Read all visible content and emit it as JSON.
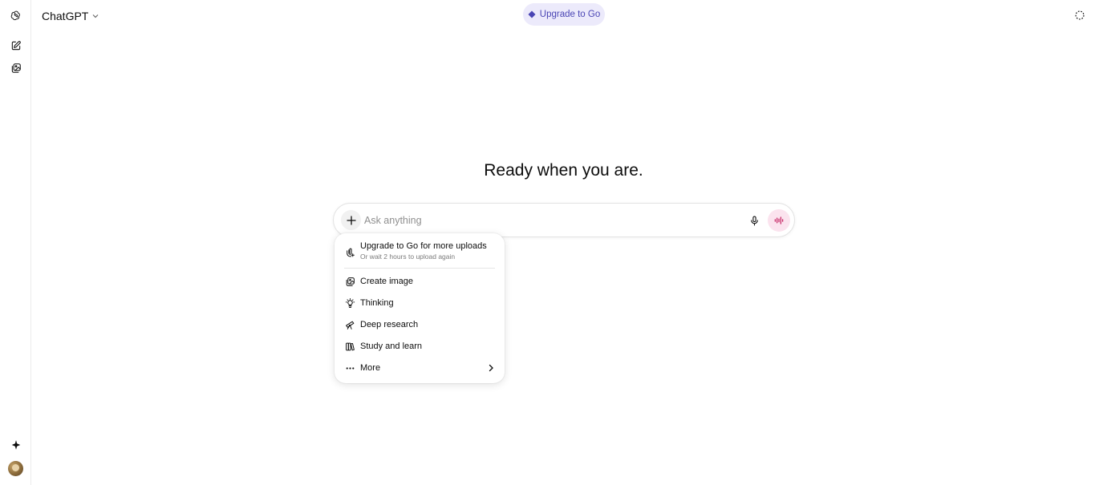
{
  "app": {
    "title": "ChatGPT"
  },
  "sidebar": {
    "items": [
      {
        "name": "logo",
        "icon": "openai-logo-icon"
      },
      {
        "name": "new-chat",
        "icon": "new-chat-icon"
      },
      {
        "name": "images",
        "icon": "images-icon"
      },
      {
        "name": "explore",
        "icon": "sparkle-icon"
      },
      {
        "name": "profile",
        "icon": "avatar"
      }
    ]
  },
  "header": {
    "model_label": "ChatGPT",
    "upgrade_label": "Upgrade to Go",
    "upgrade_color": "#4a45b4"
  },
  "main": {
    "headline": "Ready when you are."
  },
  "composer": {
    "placeholder": "Ask anything",
    "value": ""
  },
  "attach_menu": {
    "upgrade": {
      "title": "Upgrade to Go for more uploads",
      "subtitle": "Or wait 2 hours to upload again"
    },
    "items": [
      {
        "label": "Create image",
        "icon": "create-image-icon"
      },
      {
        "label": "Thinking",
        "icon": "lightbulb-icon"
      },
      {
        "label": "Deep research",
        "icon": "telescope-icon"
      },
      {
        "label": "Study and learn",
        "icon": "book-icon"
      },
      {
        "label": "More",
        "icon": "more-icon"
      }
    ]
  },
  "colors": {
    "voice_button_bg": "#fbe3ee",
    "upgrade_pill_bg": "#eceafb"
  }
}
